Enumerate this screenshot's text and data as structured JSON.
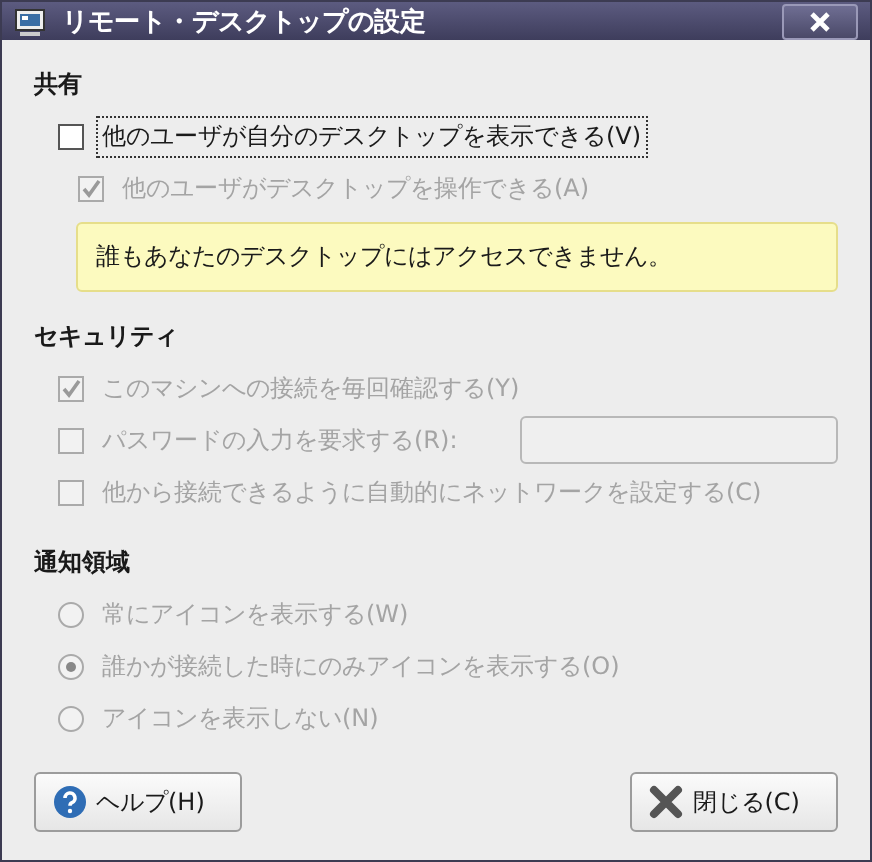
{
  "window": {
    "title": "リモート・デスクトップの設定"
  },
  "sections": [
    {
      "heading": "共有",
      "items": [
        {
          "kind": "checkbox",
          "label": "他のユーザが自分のデスクトップを表示できる(V)",
          "checked": false,
          "disabled": false,
          "focused": true,
          "children": [
            {
              "kind": "checkbox",
              "label": "他のユーザがデスクトップを操作できる(A)",
              "checked": true,
              "disabled": true,
              "focused": false
            }
          ]
        },
        {
          "kind": "info",
          "text": "誰もあなたのデスクトップにはアクセスできません。"
        }
      ]
    },
    {
      "heading": "セキュリティ",
      "items": [
        {
          "kind": "checkbox",
          "label": "このマシンへの接続を毎回確認する(Y)",
          "checked": true,
          "disabled": true,
          "focused": false
        },
        {
          "kind": "password",
          "label": "パスワードの入力を要求する(R):",
          "checked": false,
          "disabled": true,
          "focused": false
        },
        {
          "kind": "checkbox",
          "label": "他から接続できるように自動的にネットワークを設定する(C)",
          "checked": false,
          "disabled": true,
          "focused": false
        }
      ]
    },
    {
      "heading": "通知領域",
      "items": [
        {
          "kind": "radio",
          "label": "常にアイコンを表示する(W)",
          "selected": false,
          "disabled": true
        },
        {
          "kind": "radio",
          "label": "誰かが接続した時にのみアイコンを表示する(O)",
          "selected": true,
          "disabled": true
        },
        {
          "kind": "radio",
          "label": "アイコンを表示しない(N)",
          "selected": false,
          "disabled": true
        }
      ]
    }
  ],
  "buttons": [
    {
      "kind": "help",
      "label": "ヘルプ(H)"
    },
    {
      "kind": "close",
      "label": "閉じる(C)"
    }
  ]
}
